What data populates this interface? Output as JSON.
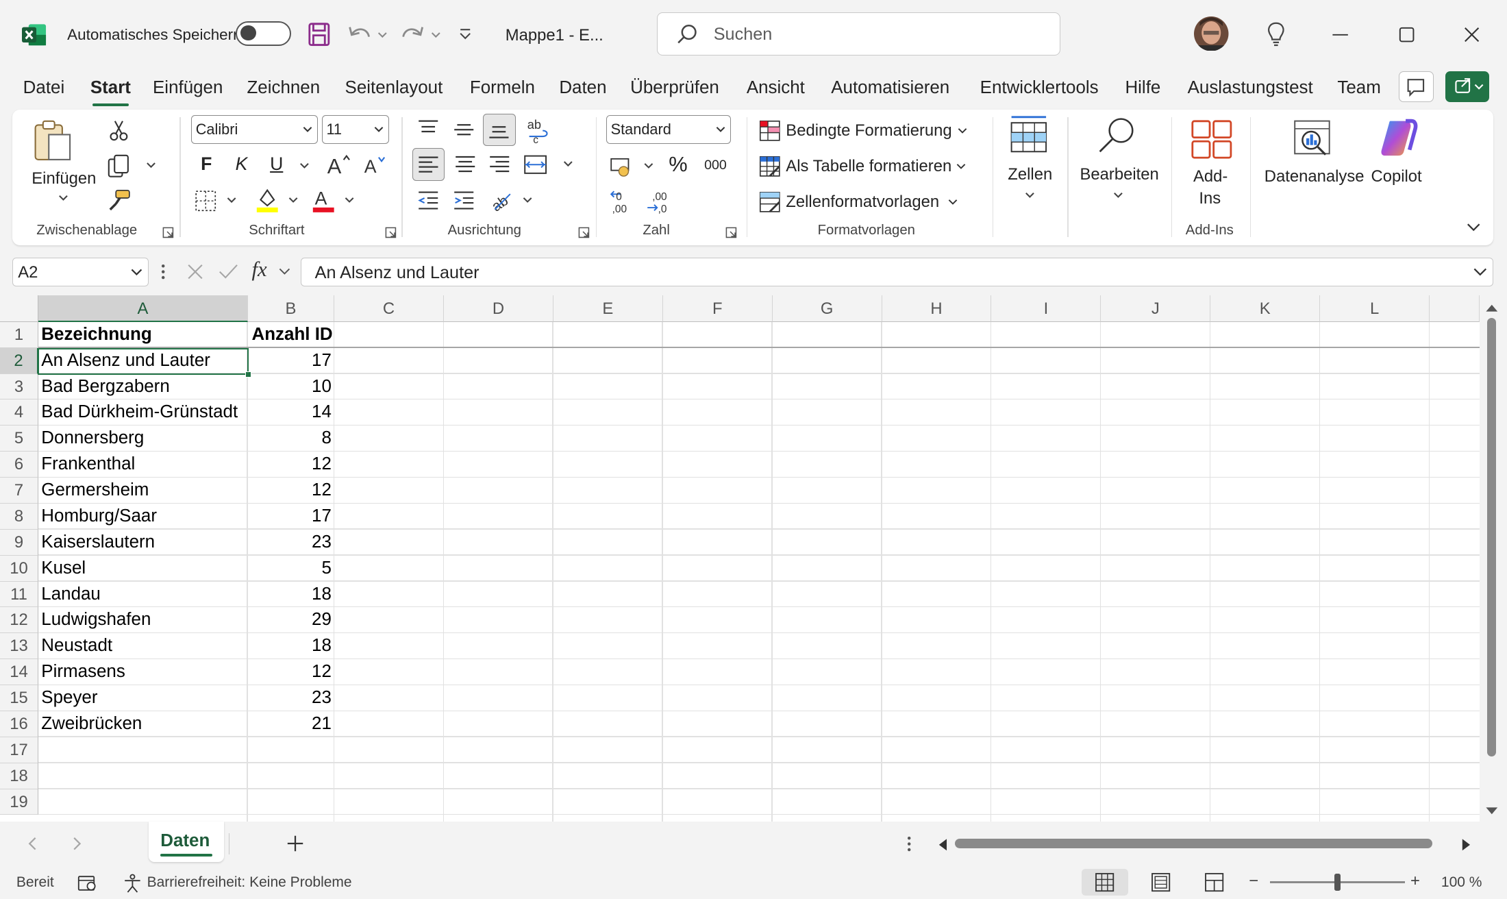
{
  "titlebar": {
    "app_icon": "excel-icon",
    "autosave_label": "Automatisches Speichern",
    "filename": "Mappe1  -  E...",
    "search_placeholder": "Suchen"
  },
  "menu": {
    "tabs": [
      "Datei",
      "Start",
      "Einfügen",
      "Zeichnen",
      "Seitenlayout",
      "Formeln",
      "Daten",
      "Überprüfen",
      "Ansicht",
      "Automatisieren",
      "Entwicklertools",
      "Hilfe",
      "Auslastungstest",
      "Team"
    ],
    "active_tab": "Start"
  },
  "ribbon": {
    "clipboard": {
      "paste_label": "Einfügen",
      "group": "Zwischenablage"
    },
    "font": {
      "name": "Calibri",
      "size": "11",
      "group": "Schriftart",
      "bold": "F",
      "italic": "K",
      "underline": "U"
    },
    "alignment": {
      "group": "Ausrichtung"
    },
    "number": {
      "format": "Standard",
      "group": "Zahl",
      "percent": "%",
      "thousands": "000"
    },
    "styles": {
      "conditional": "Bedingte Formatierung",
      "as_table": "Als Tabelle formatieren",
      "cell_styles": "Zellenformatvorlagen",
      "group": "Formatvorlagen"
    },
    "cells": {
      "label": "Zellen"
    },
    "editing": {
      "label": "Bearbeiten"
    },
    "addins": {
      "label_line1": "Add-",
      "label_line2": "Ins",
      "group": "Add-Ins"
    },
    "analysis": {
      "label": "Datenanalyse"
    },
    "copilot": {
      "label": "Copilot"
    }
  },
  "formula_bar": {
    "name_box": "A2",
    "fx": "fx",
    "content": "An Alsenz und Lauter"
  },
  "grid": {
    "columns": [
      "A",
      "B",
      "C",
      "D",
      "E",
      "F",
      "G",
      "H",
      "I",
      "J",
      "K",
      "L"
    ],
    "rows": [
      "1",
      "2",
      "3",
      "4",
      "5",
      "6",
      "7",
      "8",
      "9",
      "10",
      "11",
      "12",
      "13",
      "14",
      "15",
      "16",
      "17",
      "18",
      "19"
    ],
    "header": {
      "a": "Bezeichnung",
      "b": "Anzahl ID"
    },
    "data": [
      {
        "name": "An Alsenz und Lauter",
        "count": "17"
      },
      {
        "name": "Bad Bergzabern",
        "count": "10"
      },
      {
        "name": "Bad Dürkheim-Grünstadt",
        "count": "14"
      },
      {
        "name": "Donnersberg",
        "count": "8"
      },
      {
        "name": "Frankenthal",
        "count": "12"
      },
      {
        "name": "Germersheim",
        "count": "12"
      },
      {
        "name": "Homburg/Saar",
        "count": "17"
      },
      {
        "name": "Kaiserslautern",
        "count": "23"
      },
      {
        "name": "Kusel",
        "count": "5"
      },
      {
        "name": "Landau",
        "count": "18"
      },
      {
        "name": "Ludwigshafen",
        "count": "29"
      },
      {
        "name": "Neustadt",
        "count": "18"
      },
      {
        "name": "Pirmasens",
        "count": "12"
      },
      {
        "name": "Speyer",
        "count": "23"
      },
      {
        "name": "Zweibrücken",
        "count": "21"
      }
    ]
  },
  "sheets": {
    "active": "Daten"
  },
  "status": {
    "ready": "Bereit",
    "accessibility": "Barrierefreiheit: Keine Probleme",
    "zoom": "100 %",
    "zoom_minus": "−",
    "zoom_plus": "+"
  },
  "colors": {
    "accent": "#217346",
    "background": "#f3f3f3"
  }
}
